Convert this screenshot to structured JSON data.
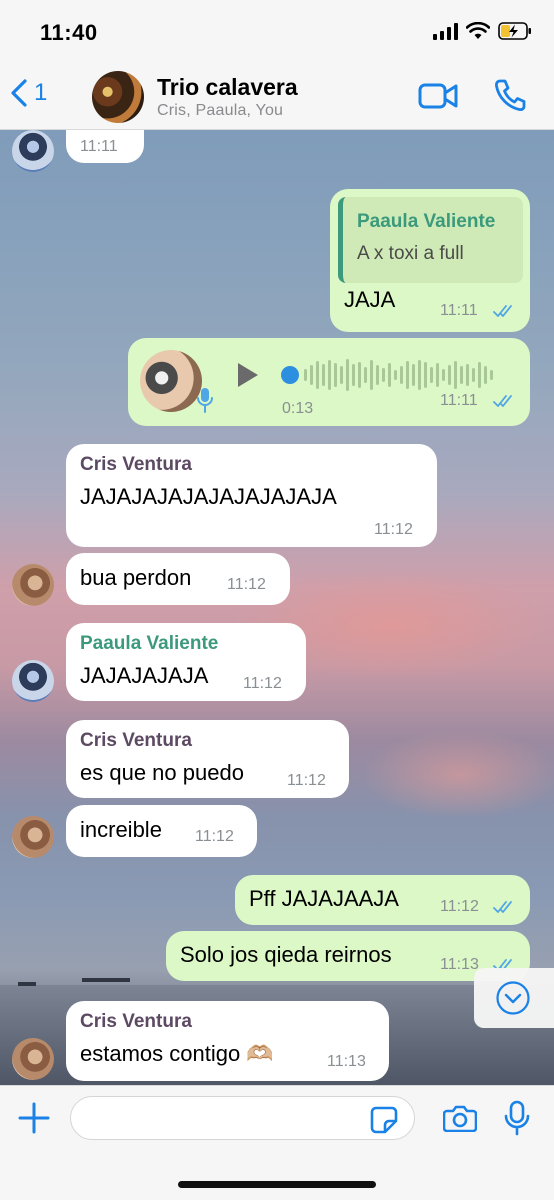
{
  "status_bar": {
    "time": "11:40"
  },
  "header": {
    "back_count": "1",
    "title": "Trio calavera",
    "members": "Cris, Paaula, You"
  },
  "messages": [
    {
      "time": "11:11"
    },
    {
      "quote_author": "Paaula Valiente",
      "quote_text": "A x toxi a full",
      "text": "JAJA",
      "time": "11:11"
    },
    {
      "duration": "0:13",
      "time": "11:11"
    },
    {
      "sender": "Cris Ventura",
      "text": "JAJAJAJAJAJAJAJAJAJA",
      "time": "11:12"
    },
    {
      "text": "bua perdon",
      "time": "11:12"
    },
    {
      "sender": "Paaula Valiente",
      "text": "JAJAJAJAJA",
      "time": "11:12"
    },
    {
      "sender": "Cris Ventura",
      "text": "es que no puedo",
      "time": "11:12"
    },
    {
      "text": "increible",
      "time": "11:12"
    },
    {
      "text": "Pff JAJAJAAJA",
      "time": "11:12"
    },
    {
      "text": "Solo jos qieda reirnos",
      "time": "11:13"
    },
    {
      "sender": "Cris Ventura",
      "text": "estamos contigo 🫶🏼",
      "time": "11:13"
    }
  ],
  "input": {
    "placeholder": ""
  },
  "icons": {
    "back": "chevron-left-icon",
    "video": "video-camera-icon",
    "call": "phone-icon",
    "play": "play-icon",
    "mic": "microphone-icon",
    "read": "double-check-icon",
    "scroll": "chevron-down-icon",
    "plus": "plus-icon",
    "sticker": "sticker-icon",
    "camera": "camera-icon"
  },
  "colors": {
    "accent": "#1a82e6",
    "outgoing_bubble": "#dcf8c6",
    "incoming_bubble": "#ffffff",
    "sender_cris": "#5c4a63",
    "sender_paaula": "#3c9a7c",
    "read_ticks": "#4fa6e6"
  }
}
